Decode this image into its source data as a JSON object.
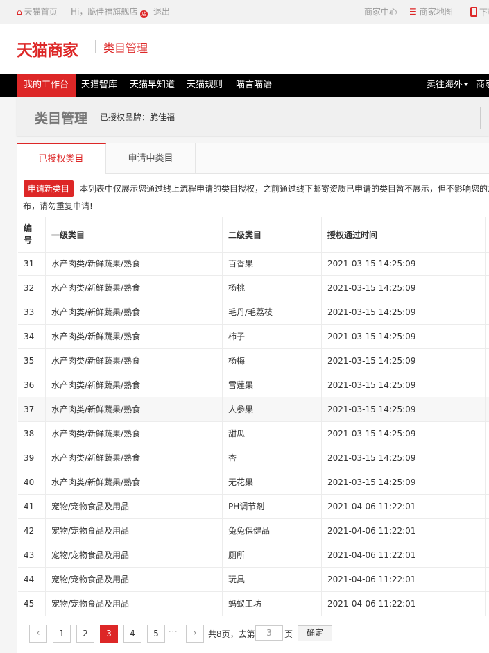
{
  "topbar": {
    "home_label": "天猫首页",
    "greeting": "Hi，脆佳福旗舰店",
    "shop_badge": "店",
    "logout_label": "退出",
    "merchant_center_label": "商家中心",
    "merchant_map_label": "商家地图-",
    "download_label": "下载"
  },
  "header": {
    "logo_text": "天猫商家",
    "page_title": "类目管理"
  },
  "nav": {
    "items": [
      {
        "label": "我的工作台",
        "active": true
      },
      {
        "label": "天猫智库"
      },
      {
        "label": "天猫早知道"
      },
      {
        "label": "天猫规则"
      },
      {
        "label": "喵言喵语"
      }
    ],
    "right_items": [
      {
        "label": "卖往海外"
      },
      {
        "label": "商家"
      }
    ]
  },
  "title_band": {
    "title": "类目管理",
    "brand_label": "已授权品牌：脆佳福"
  },
  "tabs": [
    {
      "label": "已授权类目",
      "active": true
    },
    {
      "label": "申请中类目"
    }
  ],
  "notice": {
    "apply_button": "申请新类目",
    "line1": "本列表中仅展示您通过线上流程申请的类目授权，之前通过线下邮寄资质已申请的类目暂不展示，但不影响您的发",
    "line2": "布，请勿重复申请!"
  },
  "table": {
    "headers": [
      "编号",
      "一级类目",
      "二级类目",
      "授权通过时间"
    ],
    "rows": [
      {
        "id": "31",
        "level1": "水产肉类/新鲜蔬果/熟食",
        "level2": "百香果",
        "time": "2021-03-15 14:25:09"
      },
      {
        "id": "32",
        "level1": "水产肉类/新鲜蔬果/熟食",
        "level2": "杨桃",
        "time": "2021-03-15 14:25:09"
      },
      {
        "id": "33",
        "level1": "水产肉类/新鲜蔬果/熟食",
        "level2": "毛丹/毛荔枝",
        "time": "2021-03-15 14:25:09"
      },
      {
        "id": "34",
        "level1": "水产肉类/新鲜蔬果/熟食",
        "level2": "柿子",
        "time": "2021-03-15 14:25:09"
      },
      {
        "id": "35",
        "level1": "水产肉类/新鲜蔬果/熟食",
        "level2": "杨梅",
        "time": "2021-03-15 14:25:09"
      },
      {
        "id": "36",
        "level1": "水产肉类/新鲜蔬果/熟食",
        "level2": "雪莲果",
        "time": "2021-03-15 14:25:09"
      },
      {
        "id": "37",
        "level1": "水产肉类/新鲜蔬果/熟食",
        "level2": "人参果",
        "time": "2021-03-15 14:25:09",
        "highlight": true
      },
      {
        "id": "38",
        "level1": "水产肉类/新鲜蔬果/熟食",
        "level2": "甜瓜",
        "time": "2021-03-15 14:25:09"
      },
      {
        "id": "39",
        "level1": "水产肉类/新鲜蔬果/熟食",
        "level2": "杏",
        "time": "2021-03-15 14:25:09"
      },
      {
        "id": "40",
        "level1": "水产肉类/新鲜蔬果/熟食",
        "level2": "无花果",
        "time": "2021-03-15 14:25:09"
      },
      {
        "id": "41",
        "level1": "宠物/宠物食品及用品",
        "level2": "PH调节剂",
        "time": "2021-04-06 11:22:01"
      },
      {
        "id": "42",
        "level1": "宠物/宠物食品及用品",
        "level2": "兔兔保健品",
        "time": "2021-04-06 11:22:01"
      },
      {
        "id": "43",
        "level1": "宠物/宠物食品及用品",
        "level2": "厕所",
        "time": "2021-04-06 11:22:01"
      },
      {
        "id": "44",
        "level1": "宠物/宠物食品及用品",
        "level2": "玩具",
        "time": "2021-04-06 11:22:01"
      },
      {
        "id": "45",
        "level1": "宠物/宠物食品及用品",
        "level2": "蚂蚁工坊",
        "time": "2021-04-06 11:22:01"
      }
    ]
  },
  "pagination": {
    "prev_icon": "chevron-left-icon",
    "next_icon": "chevron-right-icon",
    "pages": [
      "1",
      "2",
      "3",
      "4",
      "5"
    ],
    "current": "3",
    "ellipsis": "···",
    "total_text": "共8页，去第",
    "goto_value": "3",
    "page_suffix": "页",
    "confirm_label": "确定"
  },
  "colors": {
    "accent": "#dd2727",
    "nav_bg": "#000000"
  }
}
